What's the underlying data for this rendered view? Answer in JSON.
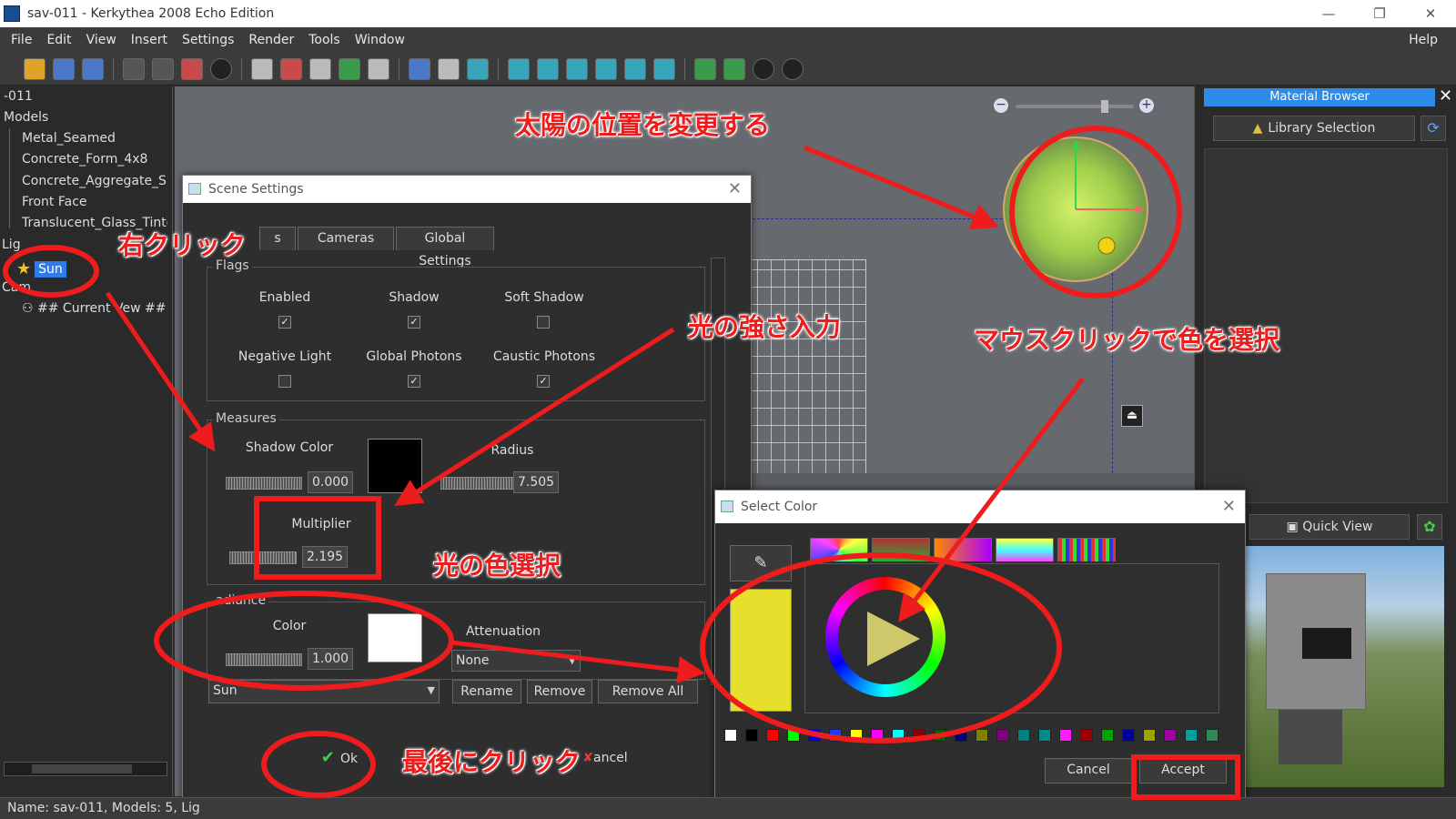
{
  "window": {
    "title": "sav-011 - Kerkythea 2008 Echo Edition"
  },
  "menu": {
    "file": "File",
    "edit": "Edit",
    "view": "View",
    "insert": "Insert",
    "settings": "Settings",
    "render": "Render",
    "tools": "Tools",
    "window": "Window",
    "help": "Help"
  },
  "tree": {
    "root": "-011",
    "models_header": "Models",
    "models": [
      "Metal_Seamed",
      "Concrete_Form_4x8",
      "Concrete_Aggregate_Sm",
      "Front Face",
      "Translucent_Glass_Tinte"
    ],
    "lights_header": "Lig",
    "sun": "Sun",
    "cameras_header": "Cam",
    "current_view": "## Current V",
    "current_view_tail": "ew ##"
  },
  "material_browser": {
    "title": "Material Browser",
    "library": "Library Selection",
    "quick_view": "Quick View"
  },
  "scene_settings": {
    "title": "Scene Settings",
    "tab_light": "s",
    "tab_cameras": "Cameras",
    "tab_global": "Global Settings",
    "flags_title": "Flags",
    "enabled": "Enabled",
    "shadow": "Shadow",
    "soft_shadow": "Soft Shadow",
    "negative_light": "Negative Light",
    "global_photons": "Global Photons",
    "caustic_photons": "Caustic Photons",
    "measures_title": "Measures",
    "shadow_color": "Shadow Color",
    "shadow_value": "0.000",
    "radius": "Radius",
    "radius_value": "7.505",
    "multiplier": "Multiplier",
    "multiplier_value": "2.195",
    "radiance_title": "adiance",
    "color": "Color",
    "color_value": "1.000",
    "attenuation": "Attenuation",
    "attenuation_value": "None",
    "light_select": "Sun",
    "rename": "Rename",
    "remove": "Remove",
    "remove_all": "Remove All",
    "ok": "Ok",
    "cancel": "ancel"
  },
  "select_color": {
    "title": "Select Color",
    "cancel": "Cancel",
    "accept": "Accept",
    "palette": [
      "#ffffff",
      "#000000",
      "#ff0000",
      "#00ff00",
      "#0000ff",
      "#1a3cff",
      "#ffff00",
      "#ff00ff",
      "#00ffff",
      "#8b0000",
      "#006400",
      "#000080",
      "#808000",
      "#800080",
      "#008080",
      "#008b8b",
      "#ff1aff",
      "#a00000",
      "#00a000",
      "#0000a0",
      "#a0a000",
      "#a000a0",
      "#00a0a0",
      "#2e8b57"
    ]
  },
  "status": {
    "text": "Name: sav-011, Models: 5, Lig"
  },
  "annotations": {
    "sun_position": "太陽の位置を変更する",
    "right_click": "右クリック",
    "intensity": "光の強さ入力",
    "color_pick": "マウスクリックで色を選択",
    "light_color": "光の色選択",
    "final_click": "最後にクリック"
  },
  "colors": {
    "annotation_red": "#ee1c1c",
    "selection_blue": "#2f7ce6",
    "panel_header_blue": "#2f8be8",
    "ok_green": "#3ed04a"
  }
}
